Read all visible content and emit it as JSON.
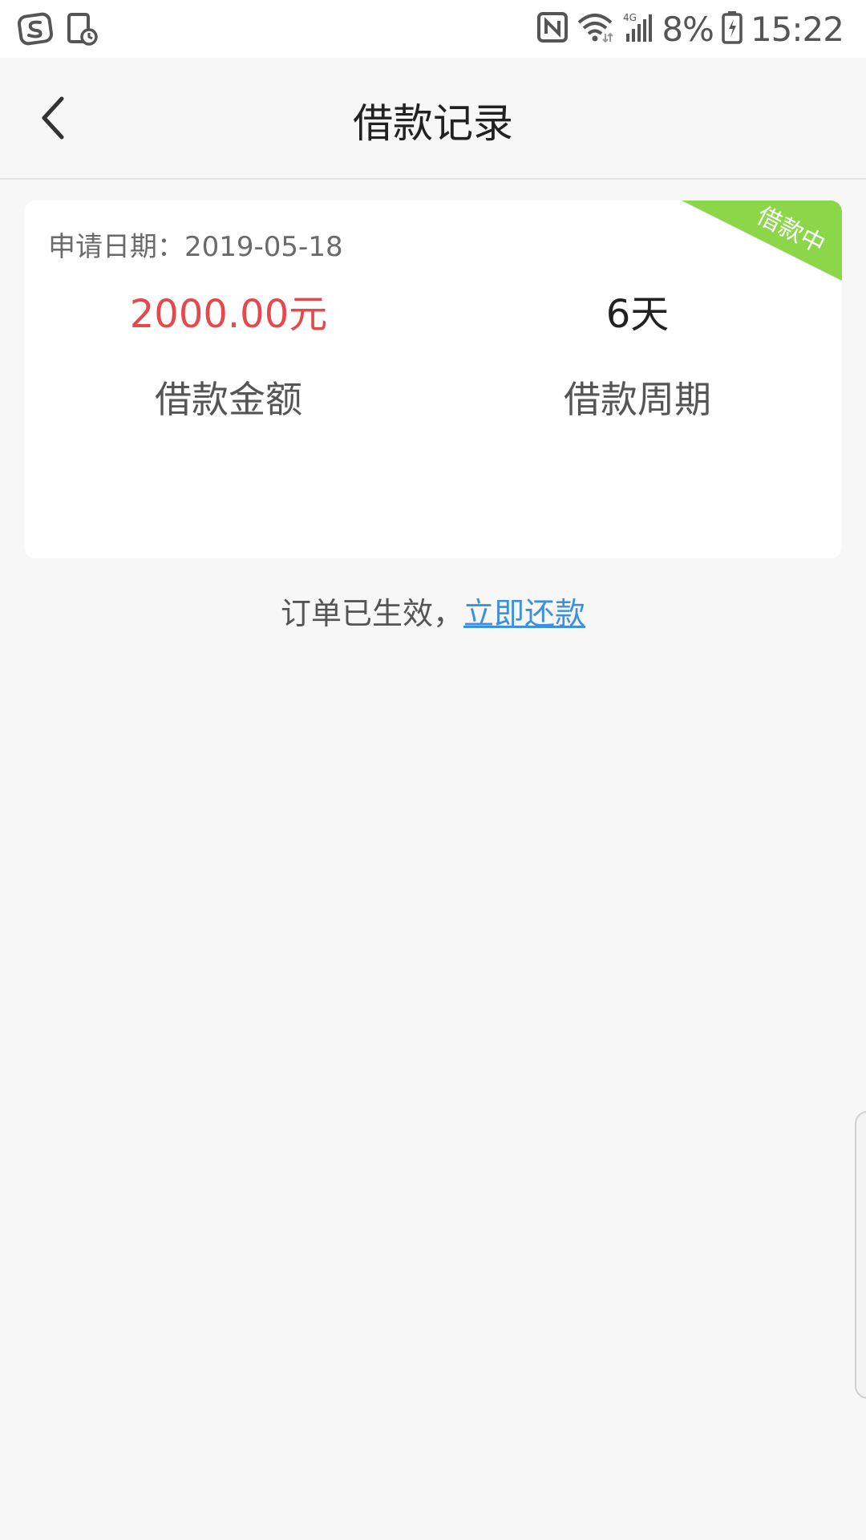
{
  "status_bar": {
    "battery_percent": "8%",
    "time": "15:22",
    "icons": [
      "sogou-icon",
      "screen-timer-icon",
      "nfc-icon",
      "wifi-icon",
      "signal-icon",
      "battery-icon"
    ]
  },
  "header": {
    "title": "借款记录"
  },
  "loan_card": {
    "apply_date": "申请日期：2019-05-18",
    "status_tag": "借款中",
    "status_color": "#8cd64a",
    "amount_value": "2000.00元",
    "amount_label": "借款金额",
    "period_value": "6天",
    "period_label": "借款周期"
  },
  "footer": {
    "message": "订单已生效，",
    "repay_link": "立即还款"
  },
  "colors": {
    "accent_red": "#e5484d",
    "link_blue": "#3d8fe0",
    "background": "#f7f7f7"
  }
}
